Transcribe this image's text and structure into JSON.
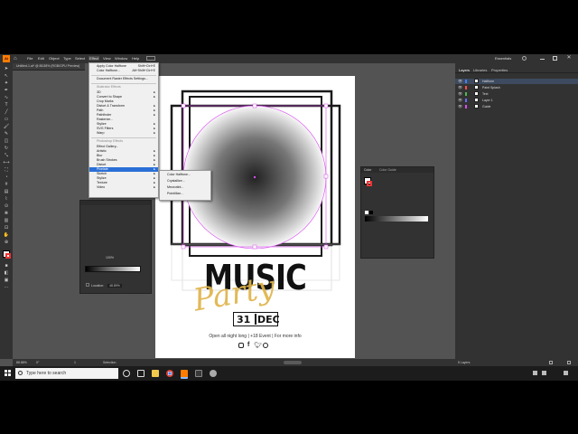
{
  "menubar": {
    "app_icon": "Ai",
    "items": [
      "File",
      "Edit",
      "Object",
      "Type",
      "Select",
      "Effect",
      "View",
      "Window",
      "Help"
    ],
    "active_item": "Effect",
    "workspace": "Essentials"
  },
  "document": {
    "tab_title": "Untitled-1.ai* @ 88.88% (RGB/GPU Preview)"
  },
  "effect_menu": {
    "top_items": [
      {
        "label": "Apply Color Halftone",
        "shortcut": "Shift+Ctrl+E"
      },
      {
        "label": "Color Halftone...",
        "shortcut": "Alt+Shift+Ctrl+E"
      }
    ],
    "doc_settings": "Document Raster Effects Settings...",
    "illustrator_header": "Illustrator Effects",
    "illustrator_items": [
      "3D",
      "Convert to Shape",
      "Crop Marks",
      "Distort & Transform",
      "Path",
      "Pathfinder",
      "Rasterize...",
      "Stylize",
      "SVG Filters",
      "Warp"
    ],
    "photoshop_header": "Photoshop Effects",
    "photoshop_items": [
      "Effect Gallery...",
      "Artistic",
      "Blur",
      "Brush Strokes",
      "Distort",
      "Pixelate",
      "Sketch",
      "Stylize",
      "Texture",
      "Video"
    ],
    "highlighted": "Pixelate"
  },
  "pixelate_submenu": {
    "items": [
      "Color Halftone...",
      "Crystallize...",
      "Mezzotint...",
      "Pointillize..."
    ]
  },
  "right_panel": {
    "tabs": [
      "Layers",
      "Libraries",
      "Properties"
    ],
    "layers": [
      {
        "name": "Halftone",
        "color": "#3f7fff"
      },
      {
        "name": "Paint Splash",
        "color": "#ff4d4d"
      },
      {
        "name": "Text",
        "color": "#4dbb4d"
      },
      {
        "name": "Layer 1",
        "color": "#6b6bff"
      },
      {
        "name": "Guide",
        "color": "#d94df0"
      }
    ],
    "layer_count": "5 Layers"
  },
  "color_panel": {
    "tabs": [
      "Color",
      "Color Guide"
    ]
  },
  "gradient_panel": {
    "opacity": "100%",
    "location": "48.89%",
    "location_label": "Location:"
  },
  "statusbar": {
    "zoom": "88.88%",
    "rotation": "0°",
    "page": "1",
    "tool": "Selection"
  },
  "poster": {
    "title": "MUSIC",
    "script": "Party",
    "date_day": "31",
    "date_month": "DEC",
    "tagline": "Open all night long | +18 Event | For more info",
    "social_icons": [
      "instagram-icon",
      "facebook-icon",
      "twitter-icon",
      "whatsapp-icon"
    ]
  },
  "taskbar": {
    "search_placeholder": "Type here to search"
  },
  "colors": {
    "accent_blue": "#2a6fd6",
    "poster_gold": "#e0b44a",
    "selection_magenta": "#d94df0",
    "ui_dark": "#323232",
    "canvas_bg": "#535353"
  }
}
